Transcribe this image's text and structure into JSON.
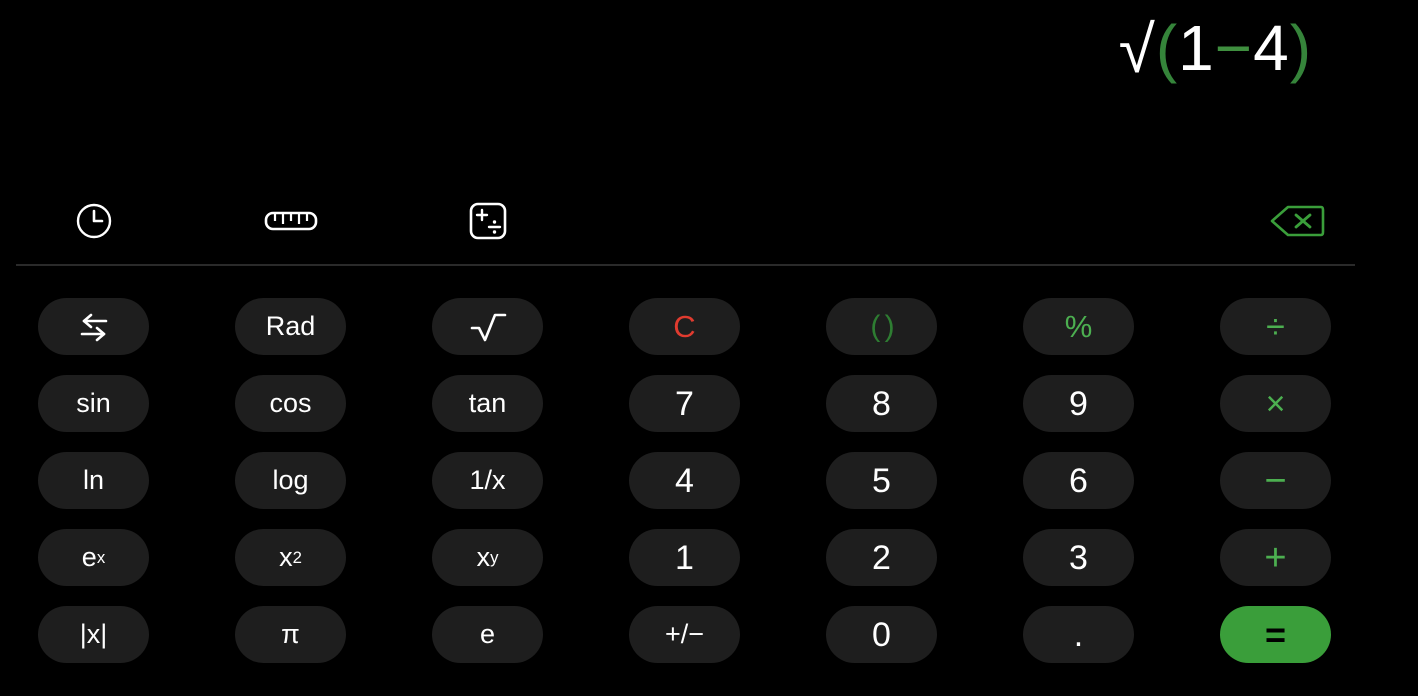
{
  "app": {
    "name": "Calculator",
    "mode": "scientific",
    "background_color": "#000000"
  },
  "display": {
    "expression": "√(1−4)",
    "tokens": [
      {
        "text": "√",
        "color": "#ffffff",
        "kind": "radical"
      },
      {
        "text": "(",
        "color": "#35843a",
        "kind": "paren-open"
      },
      {
        "text": "1",
        "color": "#ffffff",
        "kind": "digit"
      },
      {
        "text": "−",
        "color": "#3f8f3f",
        "kind": "operator"
      },
      {
        "text": "4",
        "color": "#ffffff",
        "kind": "digit"
      },
      {
        "text": ")",
        "color": "#35843a",
        "kind": "paren-close"
      }
    ],
    "result": ""
  },
  "toolbar": {
    "history_label": "history-icon",
    "converter_label": "ruler-icon",
    "mathmode_label": "math-mode-icon",
    "backspace_label": "backspace-icon",
    "backspace_color": "#3a9e3a"
  },
  "colors": {
    "key_background": "#1e1e1e",
    "key_text": "#ffffff",
    "operator_green": "#4caf50",
    "paren_green": "#2e7d32",
    "clear_red": "#e03b2f",
    "equals_background": "#3a9e3a",
    "equals_text": "#000000",
    "divider": "#2a2a2a"
  },
  "keypad": {
    "columns": 7,
    "rows": 5,
    "keys": [
      {
        "label": "⇆",
        "name": "swap-mode-button",
        "style": "icon-swap"
      },
      {
        "label": "Rad",
        "name": "angle-unit-button",
        "style": "fn"
      },
      {
        "label": "√",
        "name": "square-root-button",
        "style": "fn"
      },
      {
        "label": "C",
        "name": "clear-button",
        "style": "clear"
      },
      {
        "label": "( )",
        "name": "parentheses-button",
        "style": "paren"
      },
      {
        "label": "%",
        "name": "percent-button",
        "style": "pct"
      },
      {
        "label": "÷",
        "name": "divide-button",
        "style": "op"
      },
      {
        "label": "sin",
        "name": "sine-button",
        "style": "fn"
      },
      {
        "label": "cos",
        "name": "cosine-button",
        "style": "fn"
      },
      {
        "label": "tan",
        "name": "tangent-button",
        "style": "fn"
      },
      {
        "label": "7",
        "name": "digit-7-button",
        "style": "digit"
      },
      {
        "label": "8",
        "name": "digit-8-button",
        "style": "digit"
      },
      {
        "label": "9",
        "name": "digit-9-button",
        "style": "digit"
      },
      {
        "label": "×",
        "name": "multiply-button",
        "style": "op"
      },
      {
        "label": "ln",
        "name": "natural-log-button",
        "style": "fn"
      },
      {
        "label": "log",
        "name": "log-button",
        "style": "fn"
      },
      {
        "label": "1/x",
        "name": "reciprocal-button",
        "style": "fn"
      },
      {
        "label": "4",
        "name": "digit-4-button",
        "style": "digit"
      },
      {
        "label": "5",
        "name": "digit-5-button",
        "style": "digit"
      },
      {
        "label": "6",
        "name": "digit-6-button",
        "style": "digit"
      },
      {
        "label": "−",
        "name": "subtract-button",
        "style": "op"
      },
      {
        "label": "e^x",
        "name": "exponential-button",
        "style": "sup",
        "base": "e",
        "exp": "x"
      },
      {
        "label": "x^2",
        "name": "square-button",
        "style": "sup",
        "base": "x",
        "exp": "2"
      },
      {
        "label": "x^y",
        "name": "power-button",
        "style": "sup",
        "base": "x",
        "exp": "y"
      },
      {
        "label": "1",
        "name": "digit-1-button",
        "style": "digit"
      },
      {
        "label": "2",
        "name": "digit-2-button",
        "style": "digit"
      },
      {
        "label": "3",
        "name": "digit-3-button",
        "style": "digit"
      },
      {
        "label": "+",
        "name": "add-button",
        "style": "op"
      },
      {
        "label": "|x|",
        "name": "absolute-value-button",
        "style": "fn"
      },
      {
        "label": "π",
        "name": "pi-button",
        "style": "fn"
      },
      {
        "label": "e",
        "name": "euler-number-button",
        "style": "fn"
      },
      {
        "label": "+/−",
        "name": "sign-toggle-button",
        "style": "fn"
      },
      {
        "label": "0",
        "name": "digit-0-button",
        "style": "digit"
      },
      {
        "label": ".",
        "name": "decimal-point-button",
        "style": "digit"
      },
      {
        "label": "=",
        "name": "equals-button",
        "style": "equals"
      }
    ]
  }
}
